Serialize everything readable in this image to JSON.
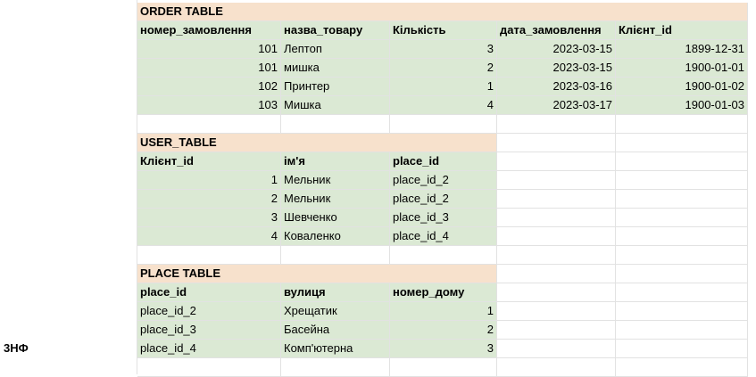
{
  "side_label": "3НФ",
  "order_table": {
    "title": "ORDER TABLE",
    "headers": [
      "номер_замовлення",
      "назва_товару",
      "Кількість",
      "дата_замовлення",
      "Клієнт_id"
    ],
    "rows": [
      [
        "101",
        "Лептоп",
        "3",
        "2023-03-15",
        "1899-12-31"
      ],
      [
        "101",
        "мишка",
        "2",
        "2023-03-15",
        "1900-01-01"
      ],
      [
        "102",
        "Принтер",
        "1",
        "2023-03-16",
        "1900-01-02"
      ],
      [
        "103",
        "Мишка",
        "4",
        "2023-03-17",
        "1900-01-03"
      ]
    ]
  },
  "user_table": {
    "title": "USER_TABLE",
    "headers": [
      "Клієнт_id",
      "ім'я",
      "place_id"
    ],
    "rows": [
      [
        "1",
        "Мельник",
        "place_id_2"
      ],
      [
        "2",
        "Мельник",
        "place_id_2"
      ],
      [
        "3",
        "Шевченко",
        "place_id_3"
      ],
      [
        "4",
        "Коваленко",
        "place_id_4"
      ]
    ]
  },
  "place_table": {
    "title": "PLACE TABLE",
    "headers": [
      "place_id",
      "вулиця",
      "номер_дому"
    ],
    "rows": [
      [
        "place_id_2",
        "Хрещатик",
        "1"
      ],
      [
        "place_id_3",
        "Басейна",
        "2"
      ],
      [
        "place_id_4",
        "Комп'ютерна",
        "3"
      ]
    ]
  }
}
